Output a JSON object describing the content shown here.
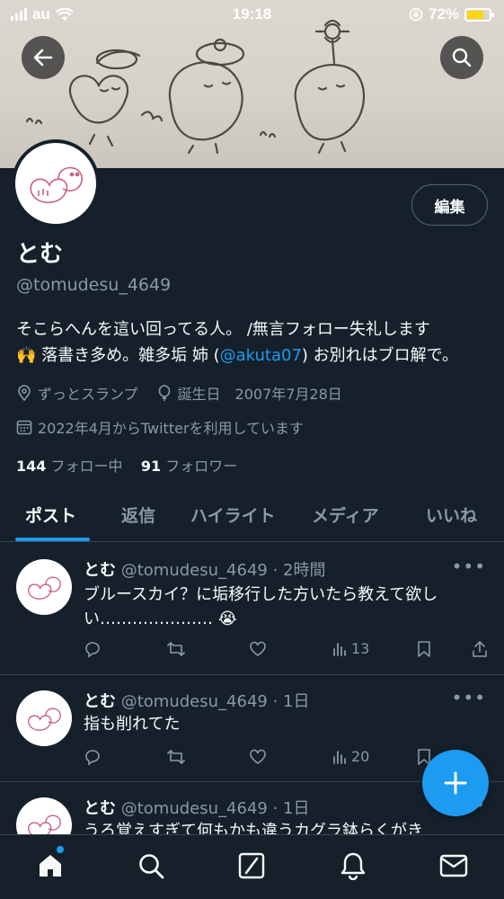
{
  "status_bar": {
    "carrier": "au",
    "time": "19:18",
    "battery": "72%"
  },
  "profile": {
    "name": "とむ",
    "handle": "@tomudesu_4649",
    "edit_label": "編集",
    "bio_line1": "そこらへんを這い回ってる人。 /無言フォロー失礼します",
    "bio_line2_a": "🙌 落書き多め。雑多垢 姉 (",
    "bio_mention": "@akuta07",
    "bio_line2_b": ") お別れはブロ解で。",
    "location": "ずっとスランプ",
    "birthday": "誕生日　2007年7月28日",
    "joined": "2022年4月からTwitterを利用しています",
    "following_count": "144",
    "following_label": "フォロー中",
    "followers_count": "91",
    "followers_label": "フォロワー"
  },
  "tabs": [
    {
      "label": "ポスト",
      "active": true
    },
    {
      "label": "返信",
      "active": false
    },
    {
      "label": "ハイライト",
      "active": false
    },
    {
      "label": "メディア",
      "active": false
    },
    {
      "label": "いいね",
      "active": false
    }
  ],
  "tweets": [
    {
      "name": "とむ",
      "handle_time": "@tomudesu_4649 · 2時間",
      "text": "ブルースカイ？に垢移行した方いたら教えて欲しい………………… 😭",
      "views": "13"
    },
    {
      "name": "とむ",
      "handle_time": "@tomudesu_4649 · 1日",
      "text": "指も削れてた",
      "views": "20"
    },
    {
      "name": "とむ",
      "handle_time": "@tomudesu_4649 · 1日",
      "text": "うろ覚えすぎて何もかも違うカグラ鉢らくがき",
      "views": ""
    }
  ],
  "icons": {
    "back": "arrow-left-icon",
    "search": "search-icon",
    "compose": "plus-icon",
    "nav": [
      "home-icon",
      "search-icon",
      "grok-icon",
      "bell-icon",
      "mail-icon"
    ]
  },
  "colors": {
    "accent": "#1d9bf0",
    "background": "#15202b",
    "muted": "#8b98a5"
  }
}
